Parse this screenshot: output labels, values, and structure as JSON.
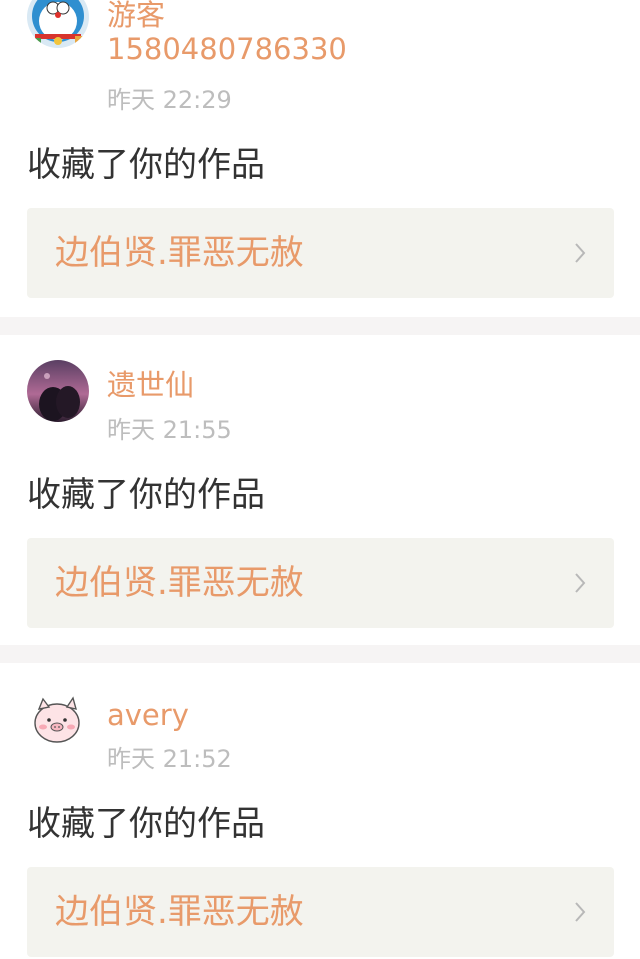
{
  "notifications": [
    {
      "user": "游客1580480786330",
      "user_line1": "游客",
      "user_line2": "1580480786330",
      "time": "昨天 22:29",
      "action": "收藏了你的作品",
      "work_title": "边伯贤.罪恶无赦",
      "avatar_icon": "doraemon-avatar-icon"
    },
    {
      "user": "遗世仙",
      "time": "昨天 21:55",
      "action": "收藏了你的作品",
      "work_title": "边伯贤.罪恶无赦",
      "avatar_icon": "photo-avatar-icon"
    },
    {
      "user": "avery",
      "time": "昨天 21:52",
      "action": "收藏了你的作品",
      "work_title": "边伯贤.罪恶无赦",
      "avatar_icon": "pig-avatar-icon"
    }
  ],
  "colors": {
    "accent": "#e89a6a",
    "timestamp": "#bdbdbd",
    "text": "#333333",
    "card_bg": "#f3f3ee",
    "separator": "#f6f4f4"
  }
}
